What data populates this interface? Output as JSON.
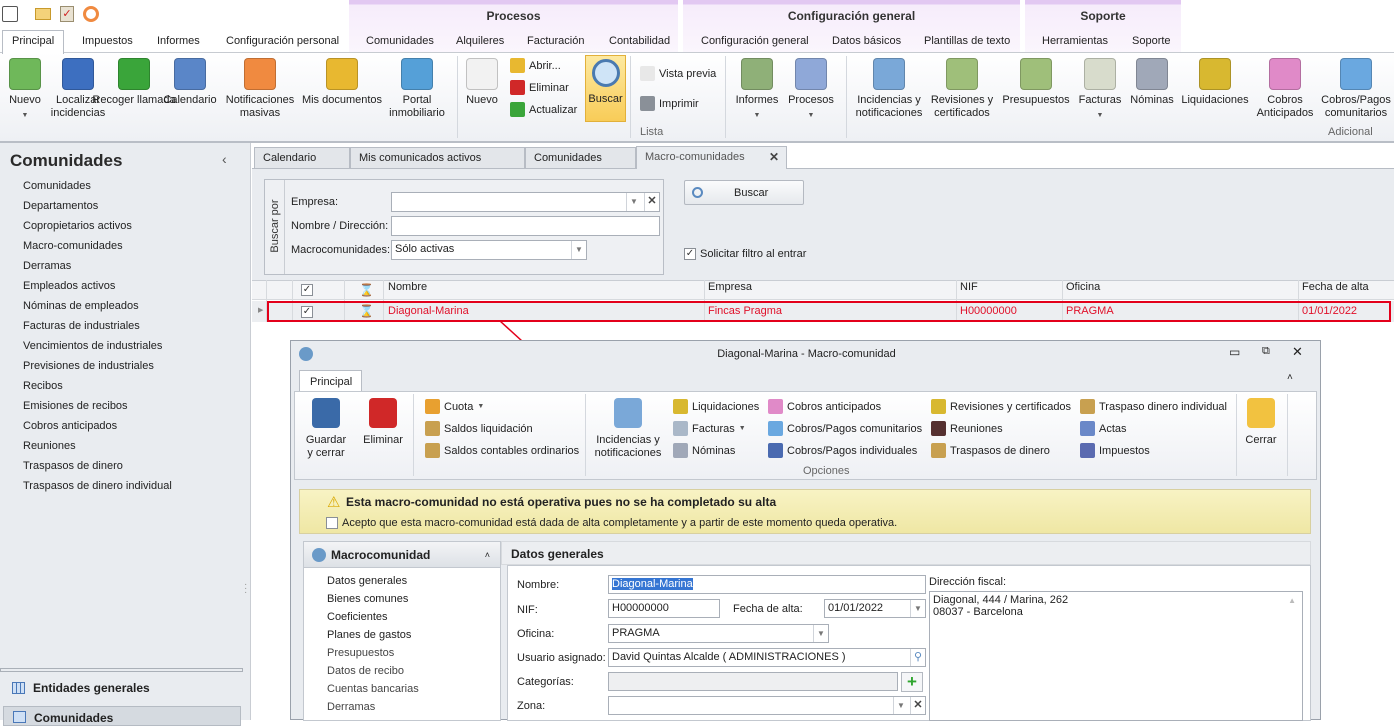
{
  "quick_access": [
    {
      "icon": "home-icon"
    },
    {
      "icon": "mail-icon"
    },
    {
      "icon": "clipboard-check-icon"
    },
    {
      "icon": "broadcast-icon"
    }
  ],
  "context_groups": [
    "Procesos",
    "Configuración general",
    "Soporte"
  ],
  "tabs": [
    "Principal",
    "Impuestos",
    "Informes",
    "Configuración personal",
    "Comunidades",
    "Alquileres",
    "Facturación",
    "Contabilidad",
    "Configuración general",
    "Datos básicos",
    "Plantillas de texto",
    "Herramientas",
    "Soporte"
  ],
  "active_tab": "Principal",
  "ribbon": {
    "large": [
      {
        "label": "Nuevo",
        "icon": "new-document-plus-icon",
        "dropdown": true
      },
      {
        "label": "Localizar incidencias",
        "icon": "file-cabinet-icon"
      },
      {
        "label": "Recoger llamada",
        "icon": "phone-icon"
      },
      {
        "label": "Calendario",
        "icon": "calendar-icon"
      },
      {
        "label": "Notificaciones masivas",
        "icon": "broadcast-icon"
      },
      {
        "label": "Mis documentos",
        "icon": "folder-icon"
      },
      {
        "label": "Portal inmobiliario",
        "icon": "portal-icon"
      },
      {
        "label": "Nuevo",
        "icon": "blank-page-icon"
      },
      {
        "label": "Buscar",
        "icon": "magnifier-icon",
        "highlighted": true
      },
      {
        "label": "Informes",
        "icon": "report-icon",
        "dropdown": true
      },
      {
        "label": "Procesos",
        "icon": "gear-icon",
        "dropdown": true
      },
      {
        "label": "Incidencias y notificaciones",
        "icon": "clipboard-check-icon"
      },
      {
        "label": "Revisiones y certificados",
        "icon": "bell-icon"
      },
      {
        "label": "Presupuestos",
        "icon": "budget-icon"
      },
      {
        "label": "Facturas",
        "icon": "invoice-icon",
        "dropdown": true
      },
      {
        "label": "Nóminas",
        "icon": "payroll-icon"
      },
      {
        "label": "Liquidaciones",
        "icon": "settlement-icon"
      },
      {
        "label": "Cobros Anticipados",
        "icon": "piggy-bank-icon"
      },
      {
        "label": "Cobros/Pagos comunitarios",
        "icon": "calculator-icon"
      }
    ],
    "small": [
      {
        "label": "Abrir...",
        "icon": "folder-open-icon"
      },
      {
        "label": "Eliminar",
        "icon": "delete-x-icon"
      },
      {
        "label": "Actualizar",
        "icon": "refresh-icon"
      },
      {
        "label": "Vista previa",
        "icon": "preview-icon"
      },
      {
        "label": "Imprimir",
        "icon": "printer-icon"
      }
    ],
    "groups": [
      "Lista",
      "Adicional"
    ]
  },
  "left_panel": {
    "title": "Comunidades",
    "items": [
      "Comunidades",
      "Departamentos",
      "Copropietarios activos",
      "Macro-comunidades",
      "Derramas",
      "Empleados activos",
      "Nóminas de empleados",
      "Facturas de industriales",
      "Vencimientos de industriales",
      "Previsiones de industriales",
      "Recibos",
      "Emisiones de recibos",
      "Cobros anticipados",
      "Reuniones",
      "Traspasos de dinero",
      "Traspasos de dinero individual"
    ],
    "sections": [
      "Entidades generales",
      "Comunidades"
    ]
  },
  "doc_tabs": [
    "Calendario",
    "Mis comunicados activos",
    "Comunidades",
    "Macro-comunidades"
  ],
  "filter": {
    "group_label": "Buscar por",
    "empresa_label": "Empresa:",
    "empresa_value": "",
    "nombre_label": "Nombre / Dirección:",
    "nombre_value": "",
    "macro_label": "Macrocomunidades:",
    "macro_value": "Sólo activas",
    "search_button": "Buscar",
    "solicitar_label": "Solicitar filtro al entrar",
    "solicitar_checked": true
  },
  "grid": {
    "columns": [
      "Nombre",
      "Empresa",
      "NIF",
      "Oficina",
      "Fecha de alta"
    ],
    "rows": [
      {
        "checked": true,
        "Nombre": "Diagonal-Marina",
        "Empresa": "Fincas Pragma",
        "NIF": "H00000000",
        "Oficina": "PRAGMA",
        "Fecha": "01/01/2022"
      }
    ],
    "highlight_color": "#e0102a"
  },
  "dialog": {
    "title": "Diagonal-Marina - Macro-comunidad",
    "tab": "Principal",
    "large": [
      {
        "label": "Guardar y cerrar",
        "icon": "save-icon"
      },
      {
        "label": "Eliminar",
        "icon": "delete-x-icon"
      },
      {
        "label": "Incidencias y notificaciones",
        "icon": "clipboard-check-icon"
      },
      {
        "label": "Cerrar",
        "icon": "folder-exit-icon"
      }
    ],
    "small": [
      {
        "label": "Cuota",
        "icon": "calendar-icon",
        "dropdown": true
      },
      {
        "label": "Saldos liquidación",
        "icon": "scales-icon"
      },
      {
        "label": "Saldos contables ordinarios",
        "icon": "scales-icon"
      },
      {
        "label": "Liquidaciones",
        "icon": "settlement-icon"
      },
      {
        "label": "Facturas",
        "icon": "invoice-icon",
        "dropdown": true
      },
      {
        "label": "Nóminas",
        "icon": "payroll-icon"
      },
      {
        "label": "Cobros anticipados",
        "icon": "piggy-bank-icon"
      },
      {
        "label": "Cobros/Pagos comunitarios",
        "icon": "calculator-icon"
      },
      {
        "label": "Cobros/Pagos individuales",
        "icon": "person-calculator-icon"
      },
      {
        "label": "Revisiones y certificados",
        "icon": "bell-icon"
      },
      {
        "label": "Reuniones",
        "icon": "people-icon"
      },
      {
        "label": "Traspasos de dinero",
        "icon": "money-transfer-icon"
      },
      {
        "label": "Traspaso dinero individual",
        "icon": "money-transfer-icon"
      },
      {
        "label": "Actas",
        "icon": "minutes-icon"
      },
      {
        "label": "Impuestos",
        "icon": "tax-icon"
      }
    ],
    "group": "Opciones",
    "warning": "Esta macro-comunidad no está operativa pues no se ha completado su alta",
    "accept_label": "Acepto que esta macro-comunidad está dada de alta completamente y a partir de este momento queda operativa.",
    "accept_checked": false,
    "nav_title": "Macrocomunidad",
    "nav_items": [
      "Datos generales",
      "Bienes comunes",
      "Coeficientes",
      "Planes de gastos",
      "Presupuestos",
      "Datos de recibo",
      "Cuentas bancarias",
      "Derramas"
    ],
    "section_title": "Datos generales",
    "form": {
      "nombre_label": "Nombre:",
      "nombre": "Diagonal-Marina",
      "nif_label": "NIF:",
      "nif": "H00000000",
      "fecha_label": "Fecha de alta:",
      "fecha": "01/01/2022",
      "oficina_label": "Oficina:",
      "oficina": "PRAGMA",
      "usuario_label": "Usuario asignado:",
      "usuario": "David Quintas Alcalde ( ADMINISTRACIONES )",
      "categorias_label": "Categorías:",
      "categorias": "",
      "zona_label": "Zona:",
      "zona": "",
      "direccion_label": "Dirección fiscal:",
      "direccion_1": "Diagonal, 444 / Marina, 262",
      "direccion_2": "08037 - Barcelona"
    }
  }
}
